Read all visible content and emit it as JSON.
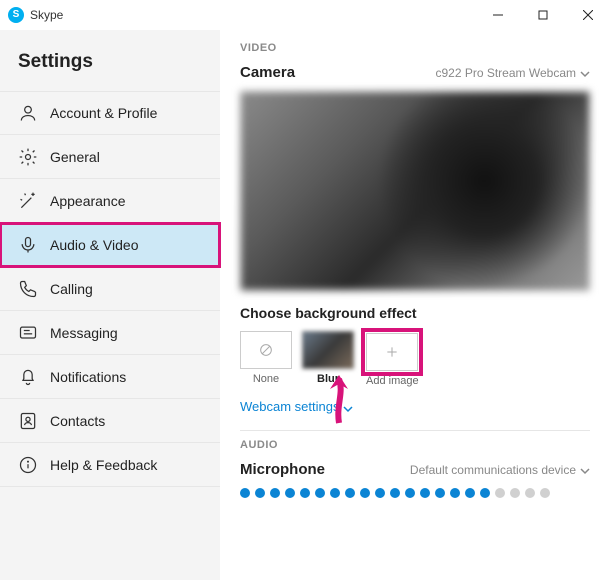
{
  "titlebar": {
    "title": "Skype"
  },
  "sidebar": {
    "heading": "Settings",
    "items": [
      {
        "label": "Account & Profile",
        "icon": "person"
      },
      {
        "label": "General",
        "icon": "gear"
      },
      {
        "label": "Appearance",
        "icon": "wand"
      },
      {
        "label": "Audio & Video",
        "icon": "mic",
        "selected": true,
        "highlighted": true
      },
      {
        "label": "Calling",
        "icon": "phone"
      },
      {
        "label": "Messaging",
        "icon": "message"
      },
      {
        "label": "Notifications",
        "icon": "bell"
      },
      {
        "label": "Contacts",
        "icon": "contacts"
      },
      {
        "label": "Help & Feedback",
        "icon": "info"
      }
    ]
  },
  "video": {
    "section": "VIDEO",
    "camera_label": "Camera",
    "camera_value": "c922 Pro Stream Webcam",
    "effect_heading": "Choose background effect",
    "effects": [
      {
        "key": "none",
        "label": "None"
      },
      {
        "key": "blur",
        "label": "Blur",
        "selected": true
      },
      {
        "key": "add",
        "label": "Add image",
        "highlighted": true
      }
    ],
    "settings_link": "Webcam settings"
  },
  "audio": {
    "section": "AUDIO",
    "mic_label": "Microphone",
    "mic_value": "Default communications device",
    "meter": {
      "on": 17,
      "total": 21
    }
  },
  "colors": {
    "accent": "#0b84d4",
    "highlight": "#d8137a",
    "skype": "#00aff0"
  }
}
